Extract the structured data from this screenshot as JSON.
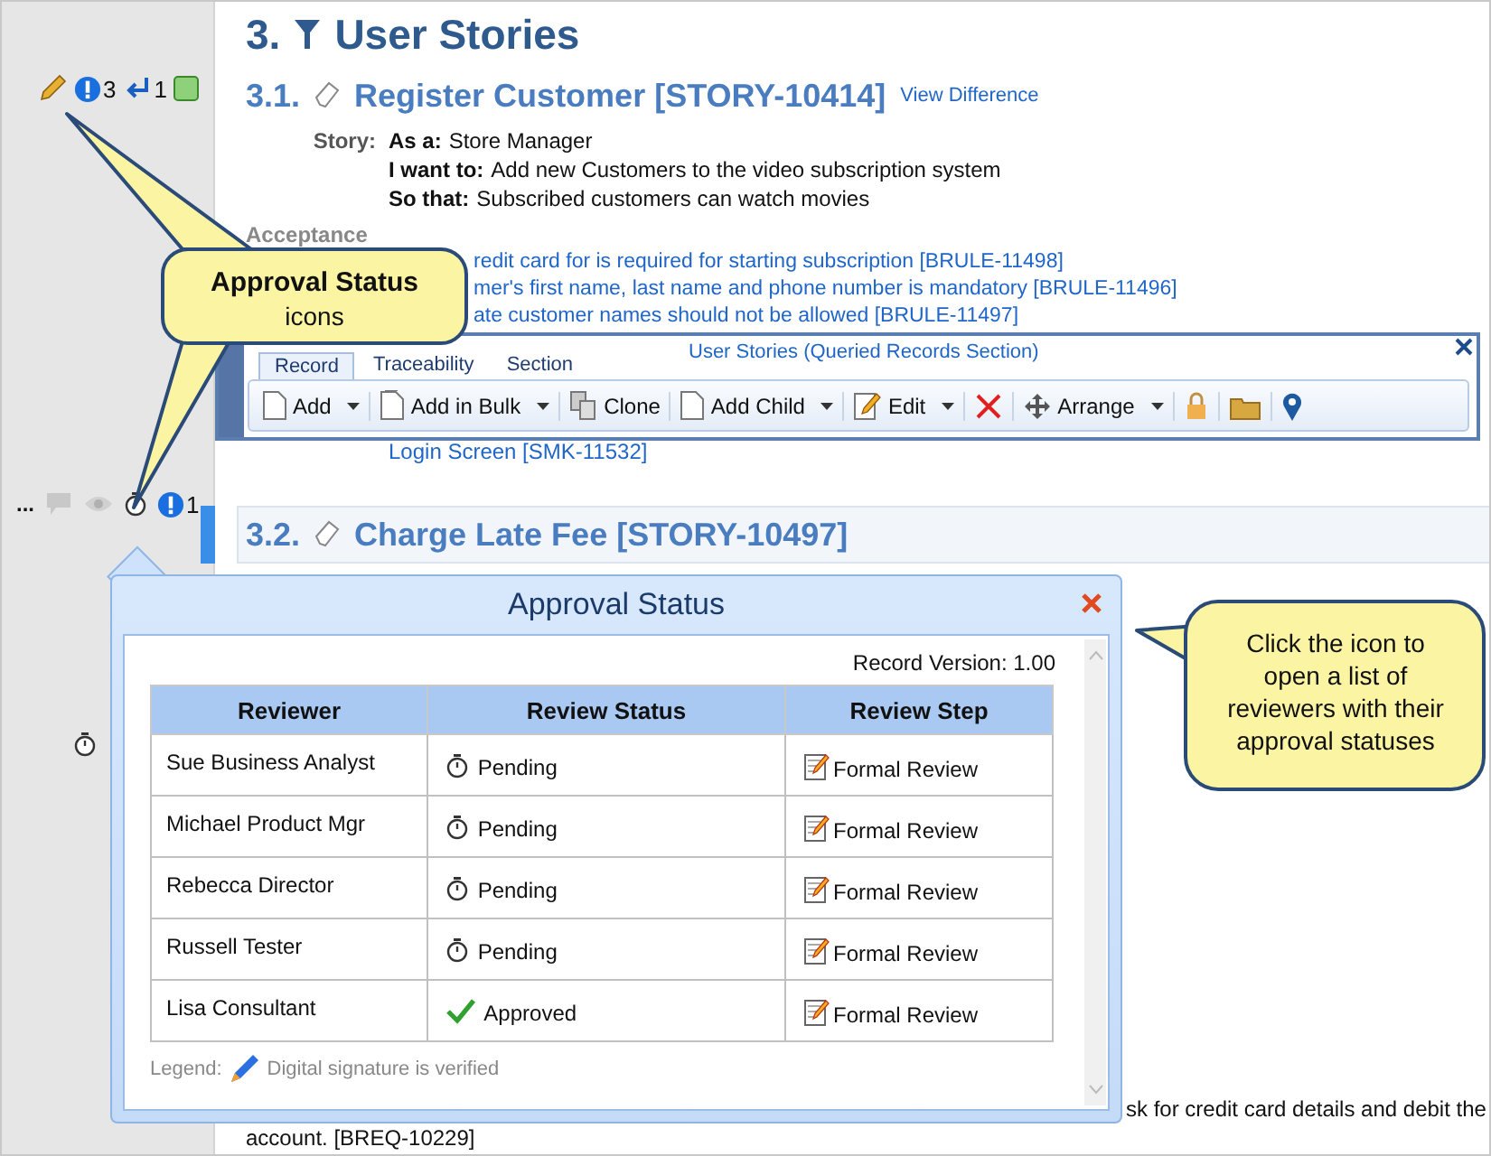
{
  "gutter": {
    "rows": [
      [
        {
          "kind": "pencil"
        },
        {
          "kind": "alert",
          "count": "3"
        },
        {
          "kind": "reply",
          "count": "1"
        },
        {
          "kind": "status"
        }
      ],
      [
        {
          "kind": "text",
          "label": "..."
        },
        {
          "kind": "comment"
        },
        {
          "kind": "eye"
        },
        {
          "kind": "stopwatch"
        },
        {
          "kind": "alert",
          "count": "1"
        }
      ],
      [
        {
          "kind": "stopwatch"
        }
      ]
    ]
  },
  "section": {
    "number": "3.",
    "title": "User Stories"
  },
  "story": {
    "number": "3.1.",
    "title": "Register Customer [STORY-10414]",
    "link": "View Difference",
    "label": "Story:",
    "lines": [
      {
        "key": "As a:",
        "value": "Store Manager"
      },
      {
        "key": "I want to:",
        "value": "Add new Customers to the video subscription system"
      },
      {
        "key": "So that:",
        "value": "Subscribed customers can watch movies"
      }
    ],
    "acceptance_label": "Acceptance",
    "acceptance": [
      "redit card for is required for starting subscription [BRULE-11498]",
      "mer's first name, last name and phone number is mandatory [BRULE-11496]",
      "ate customer names should not be allowed [BRULE-11497]"
    ],
    "related": "Login Screen [SMK-11532]"
  },
  "toolbar_popup": {
    "title": "User Stories (Queried Records Section)",
    "tabs": [
      {
        "label": "Record",
        "selected": true
      },
      {
        "label": "Traceability",
        "selected": false
      },
      {
        "label": "Section",
        "selected": false
      }
    ],
    "buttons": [
      {
        "kind": "add",
        "label": "Add",
        "dropdown": true
      },
      {
        "kind": "bulk",
        "label": "Add in Bulk",
        "dropdown": true
      },
      {
        "kind": "clone",
        "label": "Clone",
        "dropdown": false
      },
      {
        "kind": "child",
        "label": "Add Child",
        "dropdown": true
      },
      {
        "kind": "edit",
        "label": "Edit",
        "dropdown": true
      },
      {
        "kind": "delete",
        "dropdown": false
      },
      {
        "kind": "arrange",
        "label": "Arrange",
        "dropdown": true
      },
      {
        "kind": "lock",
        "dropdown": false
      },
      {
        "kind": "folder",
        "dropdown": false
      },
      {
        "kind": "pin",
        "dropdown": false
      }
    ]
  },
  "story2": {
    "number": "3.2.",
    "title": "Charge Late Fee [STORY-10497]",
    "selected": true
  },
  "bottom_text": [
    "sk for credit card details and debit the",
    "account. [BREQ-10229]"
  ],
  "dialog": {
    "title": "Approval Status",
    "record_version": "Record Version: 1.00",
    "columns": [
      "Reviewer",
      "Review Status",
      "Review Step"
    ],
    "rows": [
      {
        "reviewer": "Sue Business Analyst",
        "status": "Pending",
        "kind": "pending",
        "step": "Formal Review"
      },
      {
        "reviewer": "Michael Product Mgr",
        "status": "Pending",
        "kind": "pending",
        "step": "Formal Review"
      },
      {
        "reviewer": "Rebecca Director",
        "status": "Pending",
        "kind": "pending",
        "step": "Formal Review"
      },
      {
        "reviewer": "Russell Tester",
        "status": "Pending",
        "kind": "pending",
        "step": "Formal Review"
      },
      {
        "reviewer": "Lisa Consultant",
        "status": "Approved",
        "kind": "approved",
        "step": "Formal Review"
      }
    ],
    "legend_label": "Legend:",
    "legend_text": "Digital signature is verified"
  },
  "callouts": [
    {
      "title": "Approval Status",
      "text": "icons"
    },
    {
      "text": "Click the icon to open a list of reviewers with their approval statuses"
    }
  ]
}
